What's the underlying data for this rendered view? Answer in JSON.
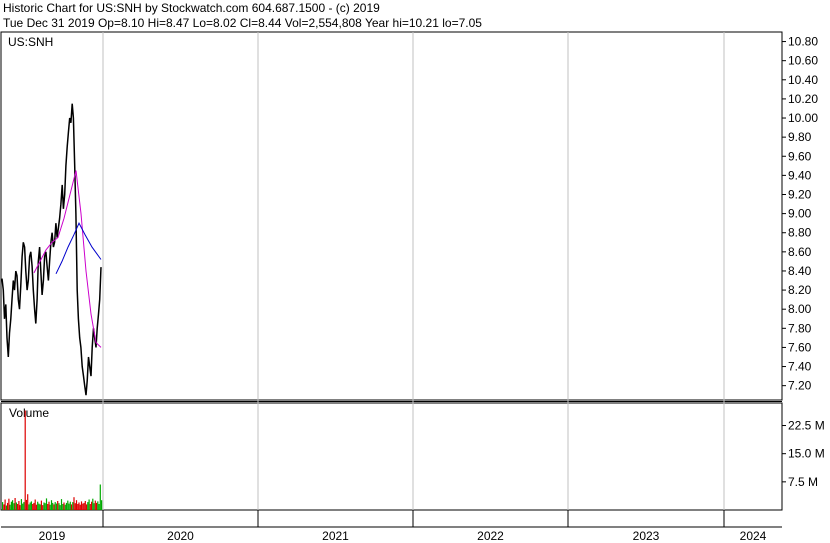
{
  "header": {
    "line1": "Historic Chart for US:SNH by Stockwatch.com 604.687.1500 - (c) 2019",
    "line2": "Tue Dec 31 2019  Op=8.10  Hi=8.47  Lo=8.02  Cl=8.44  Vol=2,554,808  Year hi=10.21  lo=7.05"
  },
  "chart_data": {
    "type": "line",
    "symbol": "US:SNH",
    "price_axis": {
      "range": [
        7.05,
        10.9
      ],
      "ticks": [
        "10.80",
        "10.60",
        "10.40",
        "10.20",
        "10.00",
        "9.80",
        "9.60",
        "9.40",
        "9.20",
        "9.00",
        "8.80",
        "8.60",
        "8.40",
        "8.20",
        "8.00",
        "7.80",
        "7.60",
        "7.40",
        "7.20"
      ]
    },
    "volume_panel": {
      "label": "Volume",
      "ticks": [
        "22.5 M",
        "15.0 M",
        "7.5 M"
      ],
      "range_millions": [
        0,
        28.5
      ]
    },
    "x_axis": {
      "labels": [
        "2019",
        "2020",
        "2021",
        "2022",
        "2023",
        "2024"
      ]
    },
    "price_series": {
      "name": "US:SNH",
      "color": "#000000",
      "close": [
        8.32,
        8.2,
        7.9,
        8.05,
        7.7,
        7.5,
        7.75,
        7.9,
        8.1,
        8.3,
        8.2,
        8.4,
        8.35,
        8.1,
        8.0,
        8.25,
        8.55,
        8.7,
        8.65,
        8.4,
        8.2,
        8.3,
        8.55,
        8.6,
        8.45,
        8.2,
        8.0,
        7.85,
        8.1,
        8.5,
        8.65,
        8.4,
        8.15,
        8.3,
        8.55,
        8.6,
        8.45,
        8.3,
        8.5,
        8.7,
        8.8,
        8.65,
        8.7,
        8.9,
        8.75,
        8.85,
        8.95,
        9.1,
        9.3,
        9.05,
        9.2,
        9.5,
        9.7,
        9.85,
        10.0,
        9.95,
        10.15,
        10.0,
        9.5,
        9.0,
        8.2,
        7.9,
        7.7,
        7.6,
        7.4,
        7.3,
        7.2,
        7.1,
        7.25,
        7.5,
        7.4,
        7.3,
        7.6,
        7.8,
        7.7,
        7.6,
        7.8,
        7.95,
        8.1,
        8.44
      ]
    },
    "moving_average_short": {
      "color": "#cc00cc",
      "values": [
        [
          34,
          8.38
        ],
        [
          40,
          8.5
        ],
        [
          46,
          8.62
        ],
        [
          52,
          8.7
        ],
        [
          58,
          8.75
        ],
        [
          64,
          8.95
        ],
        [
          70,
          9.2
        ],
        [
          76,
          9.45
        ],
        [
          81,
          9.0
        ],
        [
          86,
          8.4
        ],
        [
          91,
          7.95
        ],
        [
          96,
          7.65
        ],
        [
          101,
          7.6
        ]
      ]
    },
    "moving_average_long": {
      "color": "#0000cc",
      "values": [
        [
          56,
          8.37
        ],
        [
          62,
          8.5
        ],
        [
          68,
          8.65
        ],
        [
          74,
          8.78
        ],
        [
          79,
          8.9
        ],
        [
          85,
          8.78
        ],
        [
          92,
          8.65
        ],
        [
          101,
          8.52
        ]
      ]
    },
    "volume_bars_millions": [
      2.1,
      1.5,
      2.8,
      1.2,
      1.9,
      3.0,
      1.4,
      2.2,
      2.6,
      1.8,
      3.2,
      2.0,
      1.6,
      2.4,
      1.3,
      2.9,
      1.7,
      2.1,
      26.5,
      2.7,
      4.2,
      1.5,
      2.0,
      2.3,
      1.6,
      1.9,
      2.8,
      1.4,
      2.2,
      1.7,
      1.5,
      2.5,
      1.3,
      2.0,
      1.8,
      3.1,
      1.6,
      2.2,
      1.4,
      2.6,
      1.9,
      1.5,
      2.1,
      1.7,
      2.4,
      1.8,
      1.3,
      2.9,
      1.6,
      2.0,
      1.4,
      1.9,
      2.5,
      1.7,
      2.2,
      1.5,
      2.1,
      3.4,
      1.8,
      2.6,
      1.6,
      2.0,
      1.4,
      2.3,
      1.7,
      1.9,
      2.4,
      1.5,
      2.1,
      2.8,
      1.6,
      2.2,
      3.0,
      1.8,
      2.5,
      1.9,
      2.3,
      1.6,
      6.8,
      2.6
    ],
    "colors": {
      "up_volume": "#00aa00",
      "down_volume": "#dd0000",
      "grid": "#c0c0c0",
      "ma_short": "#cc00cc",
      "ma_long": "#0000cc"
    }
  }
}
